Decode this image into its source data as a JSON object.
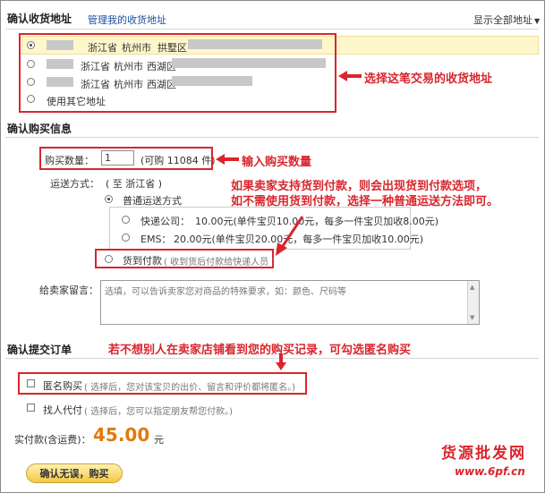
{
  "address_section": {
    "title": "确认收货地址",
    "manage_link": "管理我的收货地址",
    "show_all": "显示全部地址",
    "options": [
      {
        "province": "浙江省",
        "city": "杭州市",
        "district": "拱墅区",
        "selected": true
      },
      {
        "province": "浙江省",
        "city": "杭州市",
        "district": "西湖区",
        "selected": false
      },
      {
        "province": "浙江省",
        "city": "杭州市",
        "district": "西湖区",
        "selected": false
      }
    ],
    "other_address": "使用其它地址",
    "annotation": "选择这笔交易的收货地址"
  },
  "purchase_section": {
    "title": "确认购买信息",
    "qty_label": "购买数量：",
    "qty_value": "1",
    "qty_avail": "(可购 11084 件)",
    "qty_annotation": "输入购买数量",
    "ship_label": "运送方式：",
    "ship_dest": "( 至 浙江省 )",
    "ship_normal": "普通运送方式",
    "express_label": "快递公司：",
    "express_detail": "10.00元(单件宝贝10.00元，每多一件宝贝加收8.00元)",
    "ems_label": "EMS：",
    "ems_detail": "20.00元(单件宝贝20.00元，每多一件宝贝加收10.00元)",
    "cod_label": "货到付款",
    "cod_note": "( 收到货后付款给快递人员 )",
    "cod_annotation_line1": "如果卖家支持货到付款，则会出现货到付款选项，",
    "cod_annotation_line2": "如不需使用货到付款，选择一种普通运送方法即可。",
    "message_label": "给卖家留言：",
    "message_placeholder": "选填，可以告诉卖家您对商品的特殊要求，如：颜色、尺码等"
  },
  "submit_section": {
    "title": "确认提交订单",
    "anon_annotation": "若不想别人在卖家店铺看到您的购买记录，可勾选匿名购买",
    "anon_label": "匿名购买",
    "anon_note": "( 选择后，您对该宝贝的出价、留言和评价都将匿名。)",
    "proxy_label": "找人代付",
    "proxy_note": "( 选择后，您可以指定朋友帮您付款。)",
    "total_label": "实付款(含运费)：",
    "total_value": "45.00",
    "total_unit": "元",
    "confirm_button": "确认无误，购买"
  },
  "watermark": {
    "line1": "货源批发网",
    "line2": "www.6pf.cn"
  },
  "colors": {
    "annotation_red": "#d9252c",
    "highlight_row": "#fff7cc",
    "price_orange": "#e07a10",
    "link_blue": "#1a4fa0"
  }
}
